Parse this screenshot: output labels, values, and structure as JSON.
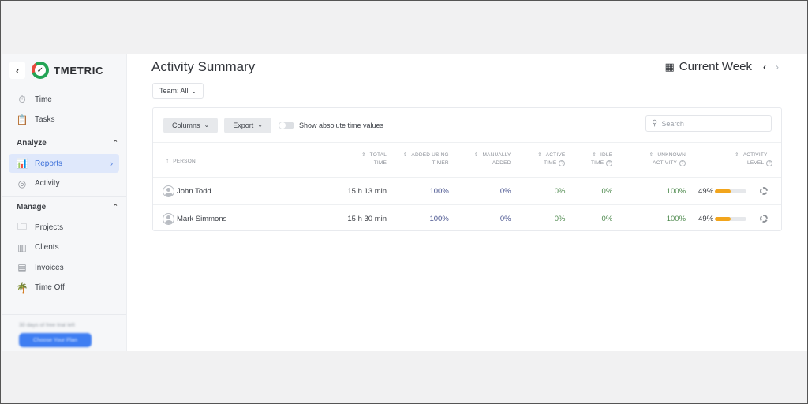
{
  "sidebar": {
    "brand": "TMETRIC",
    "top_items": [
      {
        "label": "Time",
        "icon": "stopwatch-icon"
      },
      {
        "label": "Tasks",
        "icon": "clipboard-icon"
      }
    ],
    "sections": [
      {
        "title": "Analyze",
        "items": [
          {
            "label": "Reports",
            "icon": "bar-chart-icon",
            "active": true
          },
          {
            "label": "Activity",
            "icon": "activity-icon"
          }
        ]
      },
      {
        "title": "Manage",
        "items": [
          {
            "label": "Projects",
            "icon": "folder-icon"
          },
          {
            "label": "Clients",
            "icon": "clients-icon"
          },
          {
            "label": "Invoices",
            "icon": "invoice-icon"
          },
          {
            "label": "Time Off",
            "icon": "palm-tree-icon"
          }
        ]
      }
    ],
    "trial_text": "30 days of free trial left",
    "trial_button": "Choose Your Plan"
  },
  "header": {
    "title": "Activity Summary",
    "period": "Current Week",
    "team_filter": "Team: All"
  },
  "toolbar": {
    "columns_label": "Columns",
    "export_label": "Export",
    "toggle_label": "Show absolute time values",
    "toggle_on": false,
    "search_placeholder": "Search"
  },
  "table": {
    "columns": [
      {
        "line1": "Person",
        "line2": ""
      },
      {
        "line1": "Total",
        "line2": "Time"
      },
      {
        "line1": "Added using",
        "line2": "Timer"
      },
      {
        "line1": "Manually",
        "line2": "Added"
      },
      {
        "line1": "Active",
        "line2": "Time"
      },
      {
        "line1": "Idle",
        "line2": "Time"
      },
      {
        "line1": "Unknown",
        "line2": "Activity"
      },
      {
        "line1": "Activity",
        "line2": "Level"
      }
    ],
    "rows": [
      {
        "person": "John Todd",
        "total_time": "15 h 13 min",
        "timer": "100%",
        "manual": "0%",
        "active": "0%",
        "idle": "0%",
        "unknown": "100%",
        "level": "49%",
        "level_value": 0.49
      },
      {
        "person": "Mark Simmons",
        "total_time": "15 h 30 min",
        "timer": "100%",
        "manual": "0%",
        "active": "0%",
        "idle": "0%",
        "unknown": "100%",
        "level": "49%",
        "level_value": 0.49
      }
    ]
  },
  "colors": {
    "accent": "#3b6fd9",
    "level_bar": "#f2a51c",
    "green_values": "#4e8a4e",
    "blue_values": "#4a5590"
  }
}
